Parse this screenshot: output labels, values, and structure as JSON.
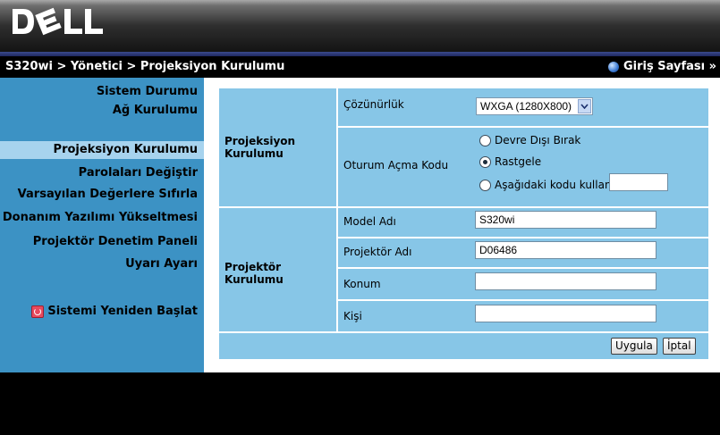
{
  "header": {
    "logo_text": "DELL"
  },
  "titlebar": {
    "breadcrumb": "S320wi > Yönetici > Projeksiyon Kurulumu",
    "home_link": "Giriş Sayfası »"
  },
  "sidebar": {
    "items": [
      {
        "label": "Sistem Durumu"
      },
      {
        "label": "Ağ Kurulumu"
      },
      {
        "label": "Projeksiyon Kurulumu",
        "selected": true
      },
      {
        "label": "Parolaları Değiştir"
      },
      {
        "label": "Varsayılan Değerlere Sıfırla"
      },
      {
        "label": "Donanım Yazılımı Yükseltmesi"
      },
      {
        "label": "Projektör Denetim Paneli"
      },
      {
        "label": "Uyarı Ayarı"
      }
    ],
    "restart_label": "Sistemi Yeniden Başlat"
  },
  "projection": {
    "group_label_line1": "Projeksiyon",
    "group_label_line2": "Kurulumu",
    "resolution_label": "Çözünürlük",
    "resolution_value": "WXGA (1280X800)",
    "login_code_label": "Oturum Açma Kodu",
    "options": [
      {
        "label": "Devre Dışı Bırak",
        "checked": false
      },
      {
        "label": "Rastgele",
        "checked": true
      },
      {
        "label": "Aşağıdaki kodu kullan",
        "checked": false
      }
    ],
    "code_value": ""
  },
  "projector": {
    "group_label": "Projektör Kurulumu",
    "model_label": "Model Adı",
    "model_value": "S320wi",
    "name_label": "Projektör Adı",
    "name_value": "D06486",
    "location_label": "Konum",
    "location_value": "",
    "contact_label": "Kişi",
    "contact_value": ""
  },
  "actions": {
    "apply_label": "Uygula",
    "cancel_label": "İptal"
  }
}
